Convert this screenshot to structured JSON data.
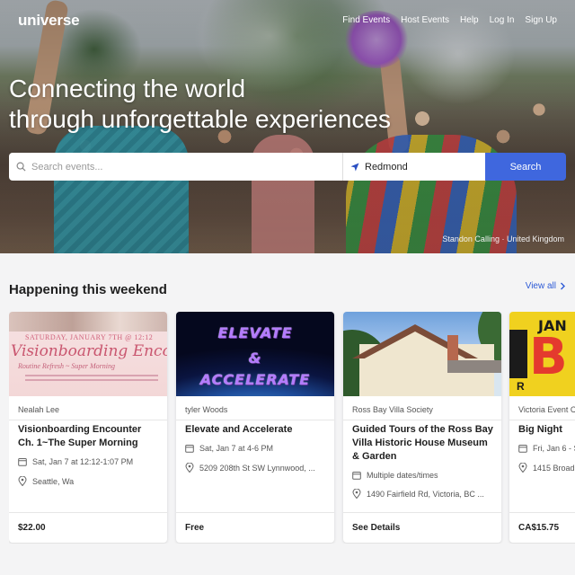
{
  "header": {
    "logo": "universe",
    "nav": [
      "Find Events",
      "Host Events",
      "Help",
      "Log In",
      "Sign Up"
    ]
  },
  "hero": {
    "headline_line1": "Connecting the world",
    "headline_line2": "through unforgettable experiences",
    "search_placeholder": "Search events...",
    "location_value": "Redmond",
    "search_button": "Search",
    "photo_credit": "Standon Calling · United Kingdom"
  },
  "section": {
    "title": "Happening this weekend",
    "view_all": "View all"
  },
  "cards": [
    {
      "organizer": "Nealah Lee",
      "title": "Visionboarding Encounter Ch. 1~The Super Morning",
      "date": "Sat, Jan 7 at 12:12-1:07 PM",
      "location": "Seattle, Wa",
      "price": "$22.00",
      "image_text": {
        "date": "SATURDAY, JANUARY 7TH @ 12:12",
        "script": "Visionboarding Encounter",
        "sub": "Routine Refresh ~ Super Morning"
      }
    },
    {
      "organizer": "tyler Woods",
      "title": "Elevate and Accelerate",
      "date": "Sat, Jan 7 at 4-6 PM",
      "location": "5209 208th St SW Lynnwood, ...",
      "price": "Free",
      "image_text": {
        "line1": "ELEVATE",
        "line2": "&",
        "line3": "ACCELERATE"
      }
    },
    {
      "organizer": "Ross Bay Villa Society",
      "title": "Guided Tours of the Ross Bay Villa Historic House Museum & Garden",
      "date": "Multiple dates/times",
      "location": "1490 Fairfield Rd, Victoria, BC ...",
      "price": "See Details"
    },
    {
      "organizer": "Victoria Event C",
      "title": "Big Night",
      "date": "Fri, Jan 6 - S",
      "location": "1415 Broad",
      "price": "CA$15.75",
      "image_text": {
        "top": "JAN",
        "big": "B",
        "bottom": "R"
      }
    }
  ],
  "colors": {
    "accent": "#3f67de",
    "link": "#2d5ad6"
  },
  "icons": {
    "search": "search-icon",
    "location": "location-arrow-icon",
    "calendar": "calendar-icon",
    "pin": "map-pin-icon",
    "chevron": "chevron-right-icon"
  }
}
